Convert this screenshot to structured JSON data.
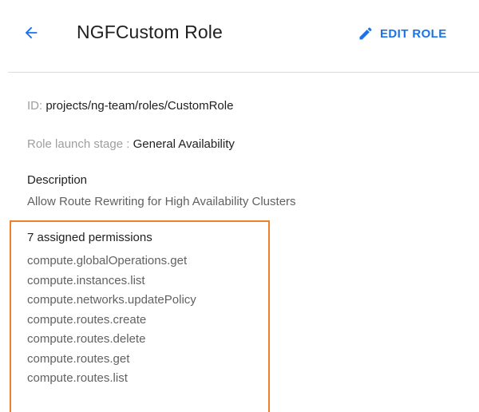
{
  "header": {
    "back_icon": "arrow-back-icon",
    "title": "NGFCustom Role",
    "edit_icon": "pencil-icon",
    "edit_label": "EDIT ROLE",
    "accent_color": "#1a73e8"
  },
  "details": {
    "id_label": "ID:",
    "id_value": "projects/ng-team/roles/CustomRole",
    "stage_label": "Role launch stage :",
    "stage_value": "General Availability",
    "description_heading": "Description",
    "description_text": "Allow Route Rewriting for High Availability Clusters"
  },
  "permissions": {
    "heading": "7 assigned permissions",
    "highlight_color": "#f07f2a",
    "items": [
      "compute.globalOperations.get",
      "compute.instances.list",
      "compute.networks.updatePolicy",
      "compute.routes.create",
      "compute.routes.delete",
      "compute.routes.get",
      "compute.routes.list"
    ]
  }
}
